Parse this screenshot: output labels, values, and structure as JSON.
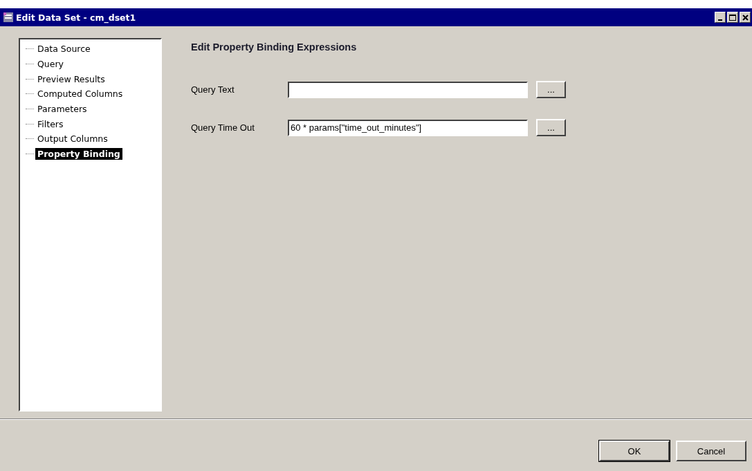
{
  "window": {
    "title": "Edit Data Set - cm_dset1"
  },
  "sidebar": {
    "items": [
      {
        "label": "Data Source",
        "selected": false
      },
      {
        "label": "Query",
        "selected": false
      },
      {
        "label": "Preview Results",
        "selected": false
      },
      {
        "label": "Computed Columns",
        "selected": false
      },
      {
        "label": "Parameters",
        "selected": false
      },
      {
        "label": "Filters",
        "selected": false
      },
      {
        "label": "Output Columns",
        "selected": false
      },
      {
        "label": "Property Binding",
        "selected": true
      }
    ]
  },
  "heading": "Edit Property Binding Expressions",
  "fields": [
    {
      "label": "Query Text",
      "button": "..."
    },
    {
      "label": "Query Time Out",
      "value": "60 * params[\"time_out_minutes\"]",
      "button": "..."
    }
  ],
  "buttons": [
    "OK",
    "Cancel"
  ]
}
